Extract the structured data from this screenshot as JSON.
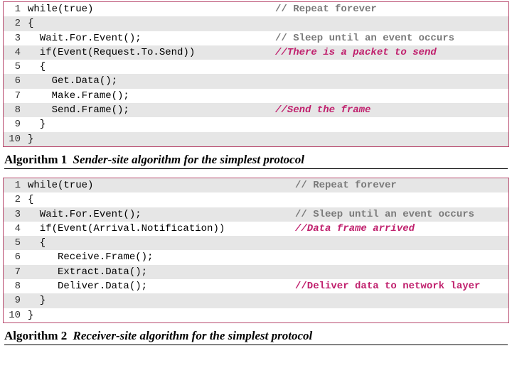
{
  "block1": {
    "lines": [
      {
        "n": 1,
        "code": "while(true)",
        "striped": false,
        "comment": "// Repeat forever",
        "commentStyle": "grey"
      },
      {
        "n": 2,
        "code": "{",
        "striped": true
      },
      {
        "n": 3,
        "code": "  Wait.For.Event();",
        "striped": false,
        "comment": "// Sleep until an event occurs",
        "commentStyle": "grey"
      },
      {
        "n": 4,
        "code": "  if(Event(Request.To.Send))",
        "striped": true,
        "comment": "//There is a packet to send",
        "commentStyle": "red"
      },
      {
        "n": 5,
        "code": "  {",
        "striped": false
      },
      {
        "n": 6,
        "code": "    Get.Data();",
        "striped": true
      },
      {
        "n": 7,
        "code": "    Make.Frame();",
        "striped": false
      },
      {
        "n": 8,
        "code": "    Send.Frame();",
        "striped": true,
        "comment": "//Send the frame",
        "commentStyle": "red"
      },
      {
        "n": 9,
        "code": "  }",
        "striped": false
      },
      {
        "n": 10,
        "code": "}",
        "striped": true
      }
    ],
    "caption_label": "Algorithm 1",
    "caption_desc": "Sender-site algorithm for the simplest protocol",
    "comment_col": 376
  },
  "block2": {
    "lines": [
      {
        "n": 1,
        "code": "while(true)",
        "striped": true,
        "comment": "// Repeat forever",
        "commentStyle": "grey"
      },
      {
        "n": 2,
        "code": "{",
        "striped": false
      },
      {
        "n": 3,
        "code": "  Wait.For.Event();",
        "striped": true,
        "comment": "// Sleep until an event occurs",
        "commentStyle": "grey"
      },
      {
        "n": 4,
        "code": "  if(Event(Arrival.Notification))",
        "striped": false,
        "comment": "//Data frame arrived",
        "commentStyle": "red"
      },
      {
        "n": 5,
        "code": "  {",
        "striped": true
      },
      {
        "n": 6,
        "code": "     Receive.Frame();",
        "striped": false
      },
      {
        "n": 7,
        "code": "     Extract.Data();",
        "striped": true
      },
      {
        "n": 8,
        "code": "     Deliver.Data();",
        "striped": false,
        "comment": "//Deliver data to network layer",
        "commentStyle": "redn"
      },
      {
        "n": 9,
        "code": "  }",
        "striped": true
      },
      {
        "n": 10,
        "code": "}",
        "striped": false
      }
    ],
    "caption_label": "Algorithm 2",
    "caption_desc": "Receiver-site algorithm for the simplest protocol",
    "comment_col": 404
  }
}
